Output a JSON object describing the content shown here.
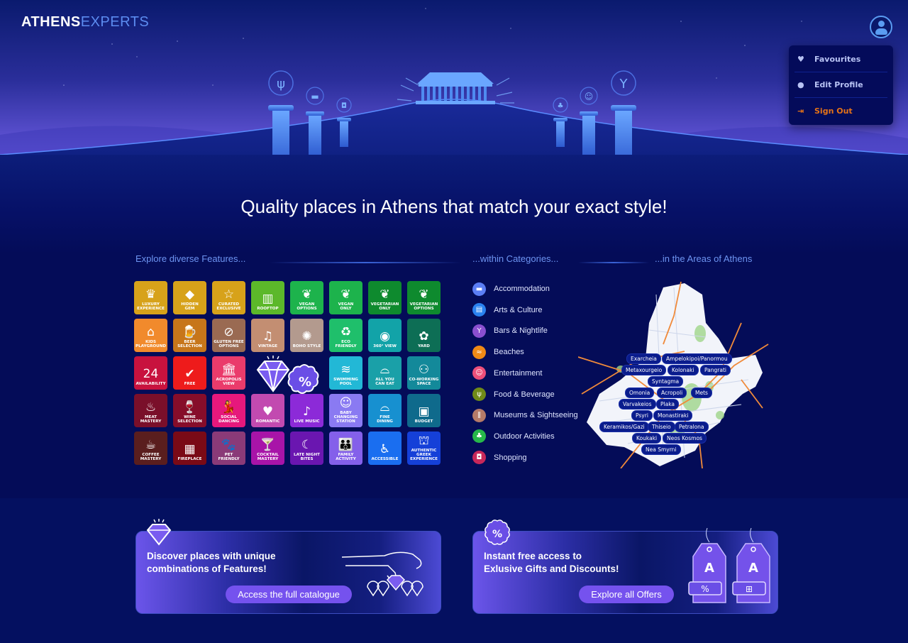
{
  "header": {
    "logo_bold": "ATHENS",
    "logo_light": "EXPERTS",
    "avatar_icon": "user-circle-icon"
  },
  "user_menu": {
    "items": [
      {
        "label": "Favourites",
        "icon": "heart-icon"
      },
      {
        "label": "Edit Profile",
        "icon": "person-icon"
      },
      {
        "label": "Sign Out",
        "icon": "sign-out-icon"
      }
    ]
  },
  "hero": {
    "pillar_icons": [
      "fork-knife-icon",
      "bed-icon",
      "shopping-bag-icon",
      "balloon-icon",
      "theatre-masks-icon",
      "cocktail-icon"
    ],
    "centerpiece": "parthenon-illustration"
  },
  "headline": "Quality places in Athens that match your exact style!",
  "sections": {
    "features_title": "Explore diverse Features...",
    "categories_title": "...within Categories...",
    "areas_title": "...in the Areas of Athens"
  },
  "features": [
    {
      "label": "Luxury\nExperience",
      "icon": "♛",
      "color": "#d7a21a"
    },
    {
      "label": "Hidden\nGem",
      "icon": "◆",
      "color": "#d7a21a"
    },
    {
      "label": "Curated\nExclusive",
      "icon": "☆",
      "color": "#d7a21a"
    },
    {
      "label": "Rooftop",
      "icon": "▥",
      "color": "#5cb82a"
    },
    {
      "label": "Vegan\nOptions",
      "icon": "❦",
      "color": "#1db34c"
    },
    {
      "label": "Vegan\nOnly",
      "icon": "❦",
      "color": "#1db34c"
    },
    {
      "label": "Vegetarian\nOnly",
      "icon": "❦",
      "color": "#0e8a2e"
    },
    {
      "label": "Vegetarian\nOptions",
      "icon": "❦",
      "color": "#0e8a2e"
    },
    {
      "label": "Kids\nPlayground",
      "icon": "⌂",
      "color": "#f18a2c"
    },
    {
      "label": "Beer\nSelection",
      "icon": "🍺",
      "color": "#c7761a"
    },
    {
      "label": "Gluten Free\nOptions",
      "icon": "⊘",
      "color": "#9a6a52"
    },
    {
      "label": "Vintage",
      "icon": "♫",
      "color": "#c38e72"
    },
    {
      "label": "Boho Style",
      "icon": "✺",
      "color": "#b39a8e"
    },
    {
      "label": "Eco\nFriendly",
      "icon": "♻",
      "color": "#1fbf6b"
    },
    {
      "label": "360° View",
      "icon": "◉",
      "color": "#12a3a8"
    },
    {
      "label": "Yard",
      "icon": "✿",
      "color": "#0d6e55"
    },
    {
      "label": "Availability",
      "icon": "24",
      "color": "#c8123e"
    },
    {
      "label": "Free",
      "icon": "✔",
      "color": "#ee1b1b"
    },
    {
      "label": "Acropolis\nView",
      "icon": "🏛",
      "color": "#ea3b6b"
    },
    {
      "label": "",
      "icon": "",
      "color": ""
    },
    {
      "label": "",
      "icon": "",
      "color": ""
    },
    {
      "label": "Swimming\nPool",
      "icon": "≋",
      "color": "#22b8d6"
    },
    {
      "label": "All You\nCan Eat",
      "icon": "⌓",
      "color": "#1aa0a8"
    },
    {
      "label": "Co-Working\nSpace",
      "icon": "⚇",
      "color": "#13899a"
    },
    {
      "label": "Meat\nMastery",
      "icon": "♨",
      "color": "#7a0f2a"
    },
    {
      "label": "Wine\nSelection",
      "icon": "🍷",
      "color": "#860d2a"
    },
    {
      "label": "Social\nDancing",
      "icon": "💃",
      "color": "#e6187c"
    },
    {
      "label": "Romantic",
      "icon": "♥",
      "color": "#c24ab0"
    },
    {
      "label": "Live Music",
      "icon": "♪",
      "color": "#8c2ad8"
    },
    {
      "label": "Baby\nChanging\nStation",
      "icon": "☺",
      "color": "#8a7af2"
    },
    {
      "label": "Fine\nDining",
      "icon": "⌓",
      "color": "#1790d0"
    },
    {
      "label": "Budget",
      "icon": "▣",
      "color": "#0f6a8c"
    },
    {
      "label": "Coffee\nMastery",
      "icon": "☕",
      "color": "#5a1e1e"
    },
    {
      "label": "Fireplace",
      "icon": "▦",
      "color": "#7a0a16"
    },
    {
      "label": "Pet\nFriendly",
      "icon": "🐾",
      "color": "#8a3a78"
    },
    {
      "label": "Cocktail\nMastery",
      "icon": "🍸",
      "color": "#a814a8"
    },
    {
      "label": "Late Night\nBites",
      "icon": "☾",
      "color": "#6a16b0"
    },
    {
      "label": "Family\nActivity",
      "icon": "👪",
      "color": "#8460ea"
    },
    {
      "label": "Accessible",
      "icon": "♿",
      "color": "#1a6ef0"
    },
    {
      "label": "Authentic\nGreek\nExperience",
      "icon": "⛫",
      "color": "#1540d8"
    }
  ],
  "categories": [
    {
      "label": "Accommodation",
      "icon": "bed-icon",
      "glyph": "▬",
      "color": "#5b7ef5"
    },
    {
      "label": "Arts & Culture",
      "icon": "book-icon",
      "glyph": "▤",
      "color": "#2a82f0"
    },
    {
      "label": "Bars & Nightlife",
      "icon": "cocktail-icon",
      "glyph": "Y",
      "color": "#8a4fcf"
    },
    {
      "label": "Beaches",
      "icon": "waves-icon",
      "glyph": "≈",
      "color": "#f08a16"
    },
    {
      "label": "Entertainment",
      "icon": "masks-icon",
      "glyph": "☺",
      "color": "#ee4f7a"
    },
    {
      "label": "Food & Beverage",
      "icon": "fork-knife-icon",
      "glyph": "ψ",
      "color": "#6f8a18"
    },
    {
      "label": "Museums & Sightseeing",
      "icon": "column-icon",
      "glyph": "⫼",
      "color": "#b57a68"
    },
    {
      "label": "Outdoor Activities",
      "icon": "tree-icon",
      "glyph": "♣",
      "color": "#27b84a"
    },
    {
      "label": "Shopping",
      "icon": "bag-icon",
      "glyph": "◘",
      "color": "#c8285a"
    }
  ],
  "areas": [
    "Exarcheia",
    "Ampelokipoi/Panormou",
    "Metaxourgeio",
    "Kolonaki",
    "Pangrati",
    "Syntagma",
    "Omonia",
    "Acropoli",
    "Mets",
    "Varvakeios",
    "Plaka",
    "Psyri",
    "Monastiraki",
    "Keramikos/Gazi",
    "Thiseio",
    "Petralona",
    "Koukaki",
    "Neos Kosmos",
    "Nea Smyrni"
  ],
  "cards": {
    "catalogue": {
      "text": "Discover places with  unique\ncombinations of Features!",
      "button": "Access the full catalogue",
      "badge_icon": "diamond-icon"
    },
    "offers": {
      "text": "Instant free access to\nExlusive Gifts and Discounts!",
      "button": "Explore all Offers",
      "badge_icon": "percent-badge-icon",
      "tag_labels": [
        "%",
        "gift"
      ]
    }
  },
  "colors": {
    "background": "#040c58",
    "accent_blue": "#5a9cf2",
    "section_title": "#6e95f2",
    "signout_orange": "#e67317",
    "button_purple": "#7552ee"
  }
}
